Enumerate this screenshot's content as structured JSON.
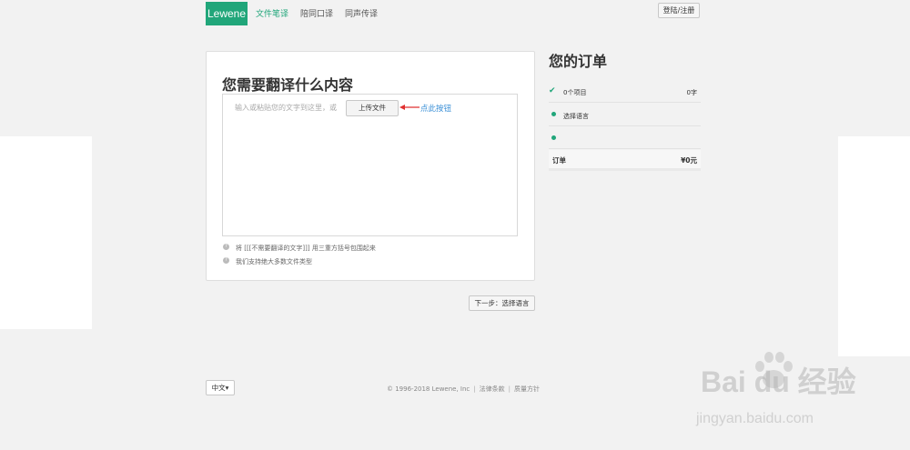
{
  "header": {
    "logo": "Lewene",
    "nav": [
      "文件笔译",
      "陪同口译",
      "同声传译"
    ],
    "login": "登陆/注册"
  },
  "main": {
    "title": "您需要翻译什么内容",
    "placeholder": "输入或粘贴您的文字到这里，或",
    "upload_label": "上传文件",
    "annotation": "点此按钮",
    "hints": [
      "将 [[[不需要翻译的文字]]] 用三重方括号包围起来",
      "我们支持绝大多数文件类型"
    ],
    "next_label": "下一步：选择语言"
  },
  "order": {
    "title": "您的订单",
    "items_label": "0个项目",
    "items_value": "0字",
    "language_label": "选择语言",
    "total_label": "订单",
    "total_value": "¥0元"
  },
  "footer": {
    "language": "中文▾",
    "copyright": "© 1996-2018 Lewene, Inc",
    "links": [
      "法律条款",
      "质量方针"
    ]
  },
  "watermark": {
    "logo": "Bai du 经验",
    "url": "jingyan.baidu.com"
  },
  "colors": {
    "brand": "#21a67a",
    "annotation": "#3a8fd6",
    "arrow": "#e03030"
  }
}
